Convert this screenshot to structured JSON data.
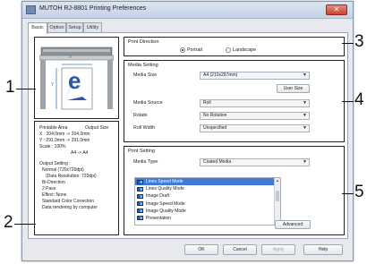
{
  "window": {
    "title": "MUTOH RJ-8801 Printing Preferences",
    "close_glyph": "✕"
  },
  "tabs": [
    "Basic",
    "Option",
    "Setup",
    "Utility"
  ],
  "printer_preview": {
    "icon_letter": "e",
    "dimension_x_label": "X",
    "dimension_y_label": "Y"
  },
  "info": {
    "printable_area_label": "Printable Area",
    "output_size_label": "Output Size",
    "x_row": "X :   204.0mm  ->   204.0mm",
    "y_row": "Y :   291.0mm  ->   291.0mm",
    "scale": "Scale :   100%",
    "paper_map": "A4  ->  A4",
    "output_setting": "Output Setting :",
    "normal": "Normal (720x720dpi)",
    "data_resolution": "(Data Resolution: 720dpi)",
    "direction": "Bi-Direction",
    "passes": "2 Pass",
    "effect": "Effect: None",
    "color_correction": "Standard Color Correction",
    "data_render": "Data rendering by computer"
  },
  "print_direction": {
    "title": "Print Direction",
    "options": [
      "Portrait",
      "Landscape"
    ],
    "selected": "Portrait"
  },
  "media_setting": {
    "title": "Media Setting",
    "media_size_label": "Media Size",
    "media_size_value": "A4 (210x297mm)",
    "user_size_button": "User Size",
    "media_source_label": "Media Source",
    "media_source_value": "Roll",
    "rotate_label": "Rotate",
    "rotate_value": "No Rotation",
    "roll_width_label": "Roll Width",
    "roll_width_value": "Unspecified"
  },
  "print_setting": {
    "title": "Print Setting",
    "media_type_label": "Media Type",
    "media_type_value": "Coated Media",
    "modes": [
      "Lines Speed Mode",
      "Lines Quality Mode",
      "Image Draft",
      "Image Speed Mode",
      "Image Quality Mode",
      "Presentation"
    ],
    "selected_mode": "Lines Speed Mode",
    "advanced_button": "Advanced"
  },
  "footer": {
    "ok": "OK",
    "cancel": "Cancel",
    "apply": "Apply",
    "help": "Help"
  },
  "callouts": [
    "1",
    "2",
    "3",
    "4",
    "5"
  ],
  "colors": {
    "selection": "#3f7ad6",
    "close": "#c8442f",
    "icon_dark": "#2c5aa0",
    "icon_light": "#7ab7e8"
  }
}
